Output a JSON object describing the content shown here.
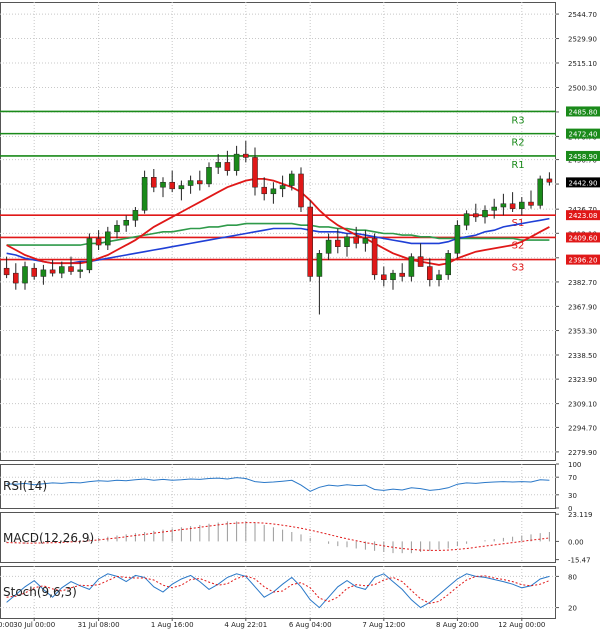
{
  "chart_data": [
    {
      "type": "candlestick",
      "panel": "price",
      "x_ticks": [
        "30 Jul 00:00",
        "31 Jul 08:00",
        "1 Aug 16:00",
        "4 Aug 22:01",
        "6 Aug 04:00",
        "7 Aug 12:00",
        "8 Aug 20:00",
        "12 Aug 00:00"
      ],
      "x_first_tick_partial": "0:00",
      "y_ticks": [
        "2544.70",
        "2529.90",
        "2515.10",
        "2500.30",
        "2485.50",
        "2470.70",
        "2456.70",
        "2441.90",
        "2426.70",
        "2412.10",
        "2397.30",
        "2382.70",
        "2367.90",
        "2353.30",
        "2338.50",
        "2323.90",
        "2309.10",
        "2294.70",
        "2279.90"
      ],
      "ylim": [
        2275.0,
        2552.0
      ],
      "last_price": "2442.90",
      "levels": [
        {
          "name": "R3",
          "value": 2485.8,
          "label": "2485.80",
          "color": "#1a8a1a"
        },
        {
          "name": "R2",
          "value": 2472.4,
          "label": "2472.40",
          "color": "#1a8a1a"
        },
        {
          "name": "R1",
          "value": 2458.9,
          "label": "2458.90",
          "color": "#1a8a1a"
        },
        {
          "name": "S1",
          "value": 2423.08,
          "label": "2423.08",
          "color": "#e01818"
        },
        {
          "name": "S2",
          "value": 2409.6,
          "label": "2409.60",
          "color": "#e01818"
        },
        {
          "name": "S3",
          "value": 2396.2,
          "label": "2396.20",
          "color": "#e01818"
        }
      ],
      "candles": [
        [
          2391,
          2398,
          2385,
          2387
        ],
        [
          2388,
          2394,
          2378,
          2382
        ],
        [
          2382,
          2395,
          2378,
          2392
        ],
        [
          2391,
          2394,
          2384,
          2386
        ],
        [
          2386,
          2393,
          2381,
          2390
        ],
        [
          2390,
          2396,
          2386,
          2388
        ],
        [
          2388,
          2395,
          2385,
          2392
        ],
        [
          2392,
          2398,
          2387,
          2389
        ],
        [
          2389,
          2395,
          2385,
          2390
        ],
        [
          2390,
          2412,
          2388,
          2409
        ],
        [
          2409,
          2414,
          2402,
          2405
        ],
        [
          2405,
          2416,
          2402,
          2413
        ],
        [
          2413,
          2420,
          2409,
          2417
        ],
        [
          2417,
          2423,
          2413,
          2420
        ],
        [
          2420,
          2428,
          2416,
          2426
        ],
        [
          2426,
          2450,
          2424,
          2446
        ],
        [
          2446,
          2451,
          2437,
          2440
        ],
        [
          2440,
          2446,
          2434,
          2443
        ],
        [
          2443,
          2450,
          2437,
          2439
        ],
        [
          2439,
          2444,
          2432,
          2441
        ],
        [
          2441,
          2447,
          2436,
          2444
        ],
        [
          2444,
          2450,
          2438,
          2442
        ],
        [
          2442,
          2455,
          2440,
          2452
        ],
        [
          2452,
          2460,
          2448,
          2455
        ],
        [
          2455,
          2462,
          2447,
          2450
        ],
        [
          2450,
          2465,
          2447,
          2460
        ],
        [
          2460,
          2468,
          2455,
          2458
        ],
        [
          2458,
          2464,
          2435,
          2440
        ],
        [
          2440,
          2446,
          2432,
          2436
        ],
        [
          2436,
          2443,
          2430,
          2439
        ],
        [
          2439,
          2447,
          2434,
          2441
        ],
        [
          2441,
          2450,
          2438,
          2448
        ],
        [
          2448,
          2452,
          2425,
          2428
        ],
        [
          2428,
          2432,
          2383,
          2386
        ],
        [
          2386,
          2402,
          2363,
          2400
        ],
        [
          2400,
          2412,
          2396,
          2408
        ],
        [
          2408,
          2415,
          2400,
          2404
        ],
        [
          2404,
          2412,
          2398,
          2410
        ],
        [
          2410,
          2416,
          2403,
          2406
        ],
        [
          2406,
          2414,
          2401,
          2409
        ],
        [
          2409,
          2412,
          2384,
          2387
        ],
        [
          2387,
          2392,
          2380,
          2384
        ],
        [
          2384,
          2390,
          2378,
          2388
        ],
        [
          2388,
          2394,
          2383,
          2386
        ],
        [
          2386,
          2400,
          2383,
          2398
        ],
        [
          2398,
          2406,
          2394,
          2392
        ],
        [
          2392,
          2397,
          2380,
          2384
        ],
        [
          2384,
          2390,
          2380,
          2387
        ],
        [
          2387,
          2402,
          2384,
          2400
        ],
        [
          2400,
          2420,
          2397,
          2417
        ],
        [
          2417,
          2426,
          2414,
          2424
        ],
        [
          2424,
          2430,
          2419,
          2422
        ],
        [
          2422,
          2429,
          2418,
          2426
        ],
        [
          2426,
          2433,
          2421,
          2428
        ],
        [
          2428,
          2436,
          2423,
          2430
        ],
        [
          2430,
          2437,
          2425,
          2427
        ],
        [
          2427,
          2434,
          2423,
          2431
        ],
        [
          2431,
          2438,
          2427,
          2429
        ],
        [
          2429,
          2447,
          2427,
          2445
        ],
        [
          2445,
          2449,
          2441,
          2443
        ]
      ],
      "ma_red": [
        2405,
        2402,
        2399,
        2397,
        2395,
        2394,
        2394,
        2394,
        2394,
        2395,
        2397,
        2399,
        2402,
        2405,
        2408,
        2412,
        2416,
        2419,
        2422,
        2425,
        2428,
        2431,
        2434,
        2437,
        2440,
        2442,
        2444,
        2445,
        2445,
        2444,
        2442,
        2440,
        2437,
        2432,
        2426,
        2421,
        2417,
        2414,
        2411,
        2409,
        2406,
        2403,
        2400,
        2398,
        2396,
        2395,
        2394,
        2393,
        2394,
        2397,
        2399,
        2401,
        2402,
        2403,
        2404,
        2405,
        2407,
        2410,
        2413,
        2416
      ],
      "ma_blue": [
        2400,
        2399,
        2397,
        2396,
        2395,
        2394,
        2394,
        2394,
        2395,
        2395,
        2396,
        2397,
        2398,
        2399,
        2400,
        2401,
        2402,
        2403,
        2404,
        2405,
        2406,
        2407,
        2408,
        2409,
        2410,
        2411,
        2412,
        2413,
        2414,
        2415,
        2415,
        2415,
        2415,
        2414,
        2413,
        2413,
        2413,
        2412,
        2412,
        2411,
        2410,
        2409,
        2408,
        2407,
        2406,
        2406,
        2406,
        2406,
        2407,
        2409,
        2410,
        2411,
        2413,
        2414,
        2416,
        2417,
        2418,
        2419,
        2420,
        2421
      ],
      "ma_green": [
        2405,
        2405,
        2405,
        2405,
        2405,
        2405,
        2405,
        2405,
        2405,
        2406,
        2406,
        2407,
        2408,
        2409,
        2410,
        2411,
        2412,
        2413,
        2413,
        2414,
        2415,
        2415,
        2416,
        2416,
        2417,
        2417,
        2418,
        2418,
        2418,
        2418,
        2418,
        2418,
        2417,
        2417,
        2416,
        2416,
        2415,
        2415,
        2414,
        2414,
        2413,
        2412,
        2412,
        2411,
        2411,
        2410,
        2410,
        2409,
        2409,
        2409,
        2409,
        2409,
        2409,
        2409,
        2409,
        2409,
        2408,
        2408,
        2408,
        2408
      ]
    },
    {
      "type": "line",
      "panel": "rsi",
      "title": "RSI(14)",
      "y_ticks": [
        "100",
        "70",
        "30",
        "0"
      ],
      "ylim": [
        0,
        100
      ],
      "values": [
        55,
        54,
        56,
        53,
        55,
        57,
        56,
        58,
        57,
        60,
        62,
        61,
        63,
        62,
        64,
        66,
        63,
        65,
        63,
        64,
        66,
        65,
        67,
        68,
        66,
        69,
        67,
        60,
        58,
        59,
        61,
        63,
        52,
        38,
        47,
        52,
        50,
        53,
        51,
        52,
        42,
        40,
        43,
        41,
        46,
        44,
        40,
        42,
        46,
        54,
        57,
        56,
        58,
        59,
        60,
        59,
        60,
        59,
        64,
        63
      ]
    },
    {
      "type": "bar",
      "panel": "macd",
      "title": "MACD(12,26,9)",
      "y_ticks": [
        "23.119",
        "0.00",
        "-15.47"
      ],
      "ylim": [
        -17.5,
        25.0
      ],
      "histogram": [
        -1,
        -1.5,
        -2,
        -1.5,
        -1,
        -0.5,
        0,
        0.5,
        1,
        2,
        3,
        4,
        5,
        6,
        7,
        8,
        9,
        10,
        11,
        12,
        13,
        14,
        15,
        16,
        17,
        17,
        17,
        16,
        14,
        12,
        10,
        8,
        6,
        3,
        0,
        -2,
        -4,
        -5,
        -6,
        -7,
        -8,
        -9,
        -10,
        -10,
        -10,
        -9,
        -8,
        -7,
        -6,
        -4,
        -2,
        0,
        1,
        2,
        3,
        4,
        5,
        6,
        7,
        8
      ],
      "signal": [
        -1,
        -1.2,
        -1.4,
        -1.4,
        -1.3,
        -1.1,
        -0.8,
        -0.4,
        0,
        0.6,
        1.3,
        2.1,
        3,
        4,
        5,
        6,
        7,
        8,
        9,
        10,
        11,
        12,
        13,
        14,
        15,
        15.6,
        16,
        16,
        15.6,
        14.8,
        13.8,
        12.6,
        11.2,
        9.6,
        7.8,
        6,
        4,
        2.2,
        0.6,
        -1,
        -2.4,
        -3.8,
        -5,
        -6,
        -6.8,
        -7.4,
        -7.6,
        -7.6,
        -7.4,
        -6.8,
        -6,
        -5,
        -4,
        -3,
        -2,
        -1,
        0,
        1,
        2,
        3
      ]
    },
    {
      "type": "line",
      "panel": "stochastic",
      "title": "Stoch(9,6,3)",
      "y_ticks": [
        "80",
        "20"
      ],
      "ylim": [
        0,
        100
      ],
      "k": [
        30,
        45,
        60,
        72,
        55,
        40,
        58,
        70,
        62,
        55,
        75,
        85,
        80,
        70,
        82,
        78,
        60,
        50,
        65,
        75,
        82,
        70,
        55,
        65,
        78,
        85,
        80,
        60,
        40,
        50,
        65,
        78,
        60,
        35,
        20,
        40,
        60,
        72,
        60,
        55,
        78,
        85,
        70,
        55,
        35,
        20,
        30,
        45,
        60,
        75,
        85,
        80,
        78,
        74,
        70,
        65,
        58,
        62,
        75,
        80
      ],
      "d": [
        40,
        42,
        48,
        58,
        62,
        56,
        52,
        58,
        63,
        62,
        64,
        72,
        80,
        78,
        77,
        77,
        73,
        63,
        58,
        63,
        74,
        76,
        69,
        63,
        66,
        76,
        81,
        75,
        60,
        50,
        52,
        64,
        68,
        58,
        38,
        32,
        40,
        57,
        64,
        62,
        64,
        73,
        78,
        70,
        53,
        37,
        28,
        32,
        45,
        60,
        73,
        80,
        81,
        77,
        74,
        70,
        64,
        62,
        65,
        72
      ]
    }
  ],
  "colors": {
    "candle_up": "#1a8a1a",
    "candle_down": "#e01818",
    "wick": "#222222",
    "ma_red": "#e01818",
    "ma_blue": "#1f3fd6",
    "ma_green": "#2f9a4a",
    "rsi": "#2a78c8",
    "macd_hist": "#9a9a9a",
    "macd_signal": "#e01818",
    "stoch_k": "#2a78c8",
    "stoch_d": "#e01818",
    "grid": "#c8c8c8",
    "axis_text": "#222222"
  }
}
